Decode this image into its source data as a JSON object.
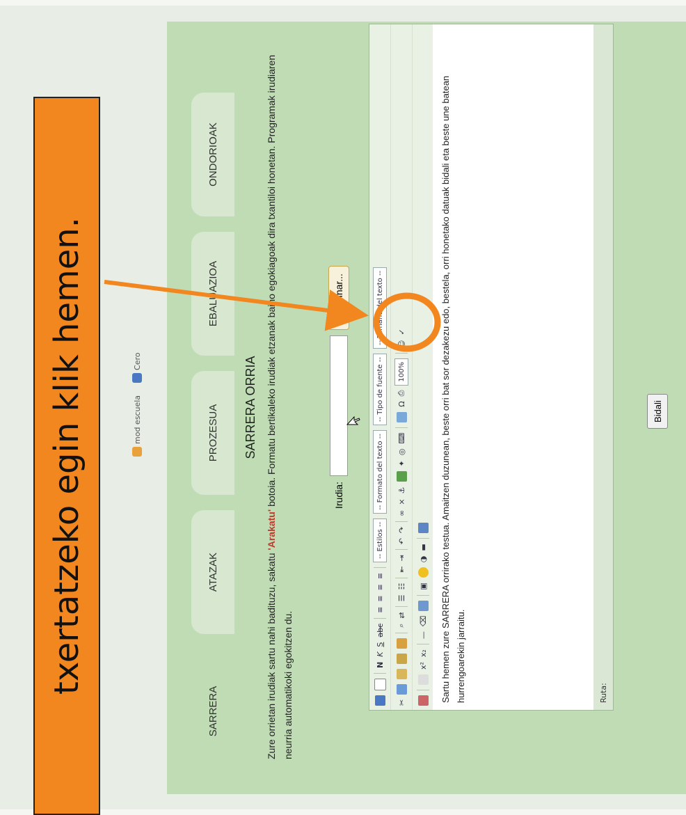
{
  "logos": {
    "left": "mod escuela",
    "right": "Cero"
  },
  "tabs": [
    "SARRERA",
    "ATAZAK",
    "PROZESUA",
    "EBALUAZIOA",
    "ONDORIOAK"
  ],
  "title": "SARRERA ORRIA",
  "intro": {
    "part1": "Zure orrietan irudiak sartu nahi badituzu, sakatu ",
    "button_word": "'Arakatu'",
    "part2": " botoia. Formatu bertikaleko irudiak etzanak baino egokiagoak dira txantiloi honetan. Programak irudiaren neurria automatikoki egokitzen du."
  },
  "file_label": "Irudia:",
  "file_button": "Examinar...",
  "toolbar": {
    "selects": [
      "-- Estilos --",
      "-- Formato del texto --",
      "-- Tipo de fuente --",
      "-- Tamaño del texto --"
    ],
    "zoom": "100%"
  },
  "editor_text": "Sartu hemen zure SARRERA orrirako testua. Amaitzen duzunean, beste orri bat sor dezakezu edo, bestela, orri honetako datuak bidali eta beste une batean hurrengoarekin jarraitu.",
  "status_label": "Ruta:",
  "submit_label": "Bidali",
  "callout_text": "txertatzeko egin klik hemen.",
  "colors": {
    "callout": "#f2861f",
    "panel": "#bfdcb4",
    "tab": "#d8e8d0"
  }
}
